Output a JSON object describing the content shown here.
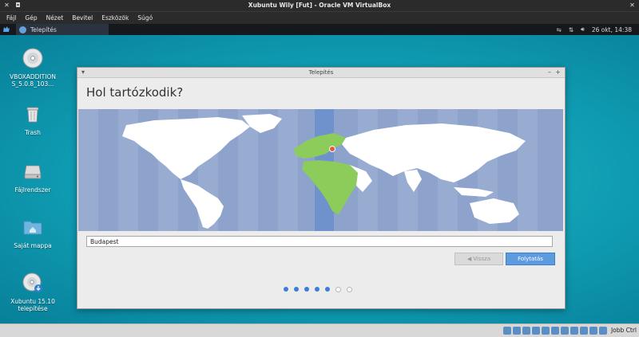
{
  "vbox": {
    "title": "Xubuntu Wily [Fut] - Oracle VM VirtualBox",
    "menu": [
      "Fájl",
      "Gép",
      "Nézet",
      "Bevitel",
      "Eszközök",
      "Súgó"
    ],
    "host_key": "Jobb Ctrl"
  },
  "panel": {
    "task_label": "Telepítés",
    "clock": "26 okt, 14:38"
  },
  "desktop": {
    "icons": [
      {
        "label": "VBOXADDITIONS_5.0.8_103..."
      },
      {
        "label": "Trash"
      },
      {
        "label": "Fájlrendszer"
      },
      {
        "label": "Saját mappa"
      },
      {
        "label": "Xubuntu 15.10 telepítése"
      }
    ]
  },
  "installer": {
    "window_title": "Telepítés",
    "heading": "Hol tartózkodik?",
    "city_value": "Budapest",
    "back_label": "Vissza",
    "continue_label": "Folytatás",
    "steps_total": 7,
    "steps_completed": 5
  },
  "colors": {
    "selected_zone": "#8ccc5a",
    "map_ocean": "#8ea3cc",
    "accent": "#5d9be0"
  }
}
